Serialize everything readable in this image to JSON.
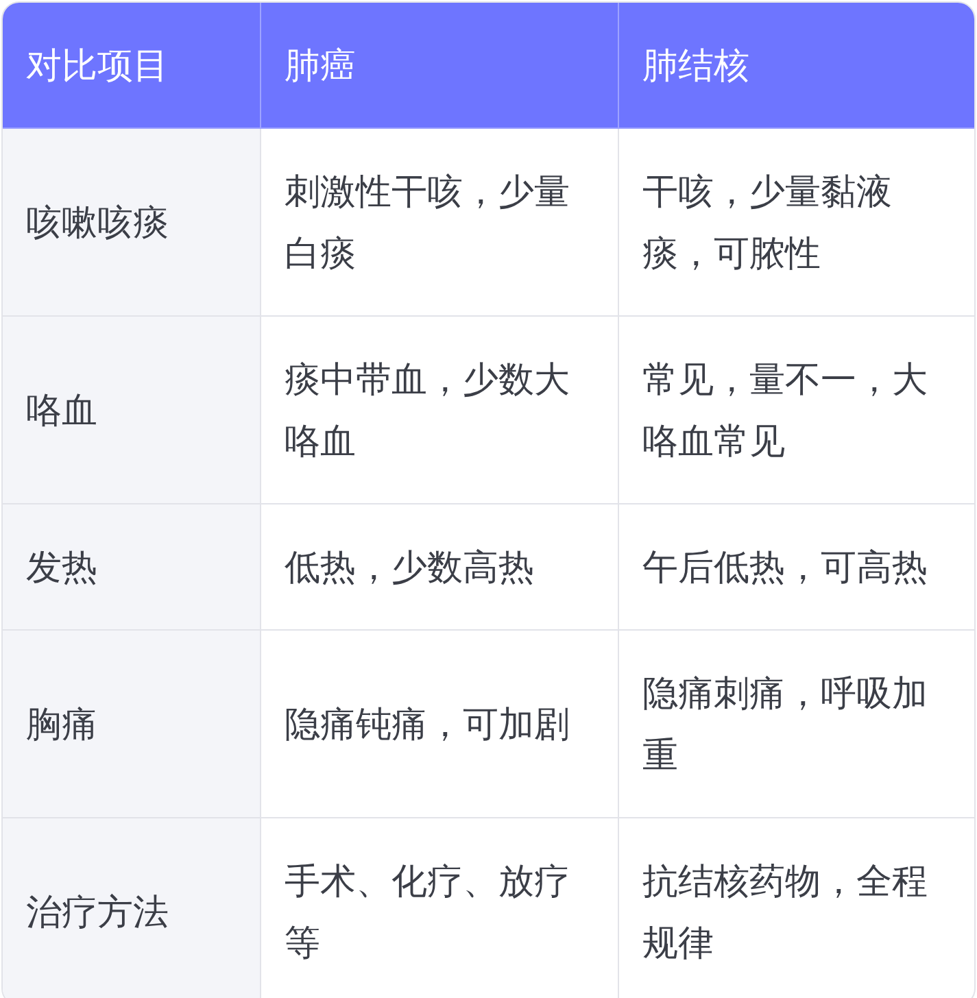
{
  "table": {
    "columns": [
      "对比项目",
      "肺癌",
      "肺结核"
    ],
    "rows": [
      [
        "咳嗽咳痰",
        "刺激性干咳，少量白痰",
        "干咳，少量黏液痰，可脓性"
      ],
      [
        "咯血",
        "痰中带血，少数大咯血",
        "常见，量不一，大咯血常见"
      ],
      [
        "发热",
        "低热，少数高热",
        "午后低热，可高热"
      ],
      [
        "胸痛",
        "隐痛钝痛，可加剧",
        "隐痛刺痛，呼吸加重"
      ],
      [
        "治疗方法",
        "手术、化疗、放疗等",
        "抗结核药物，全程规律"
      ]
    ]
  }
}
